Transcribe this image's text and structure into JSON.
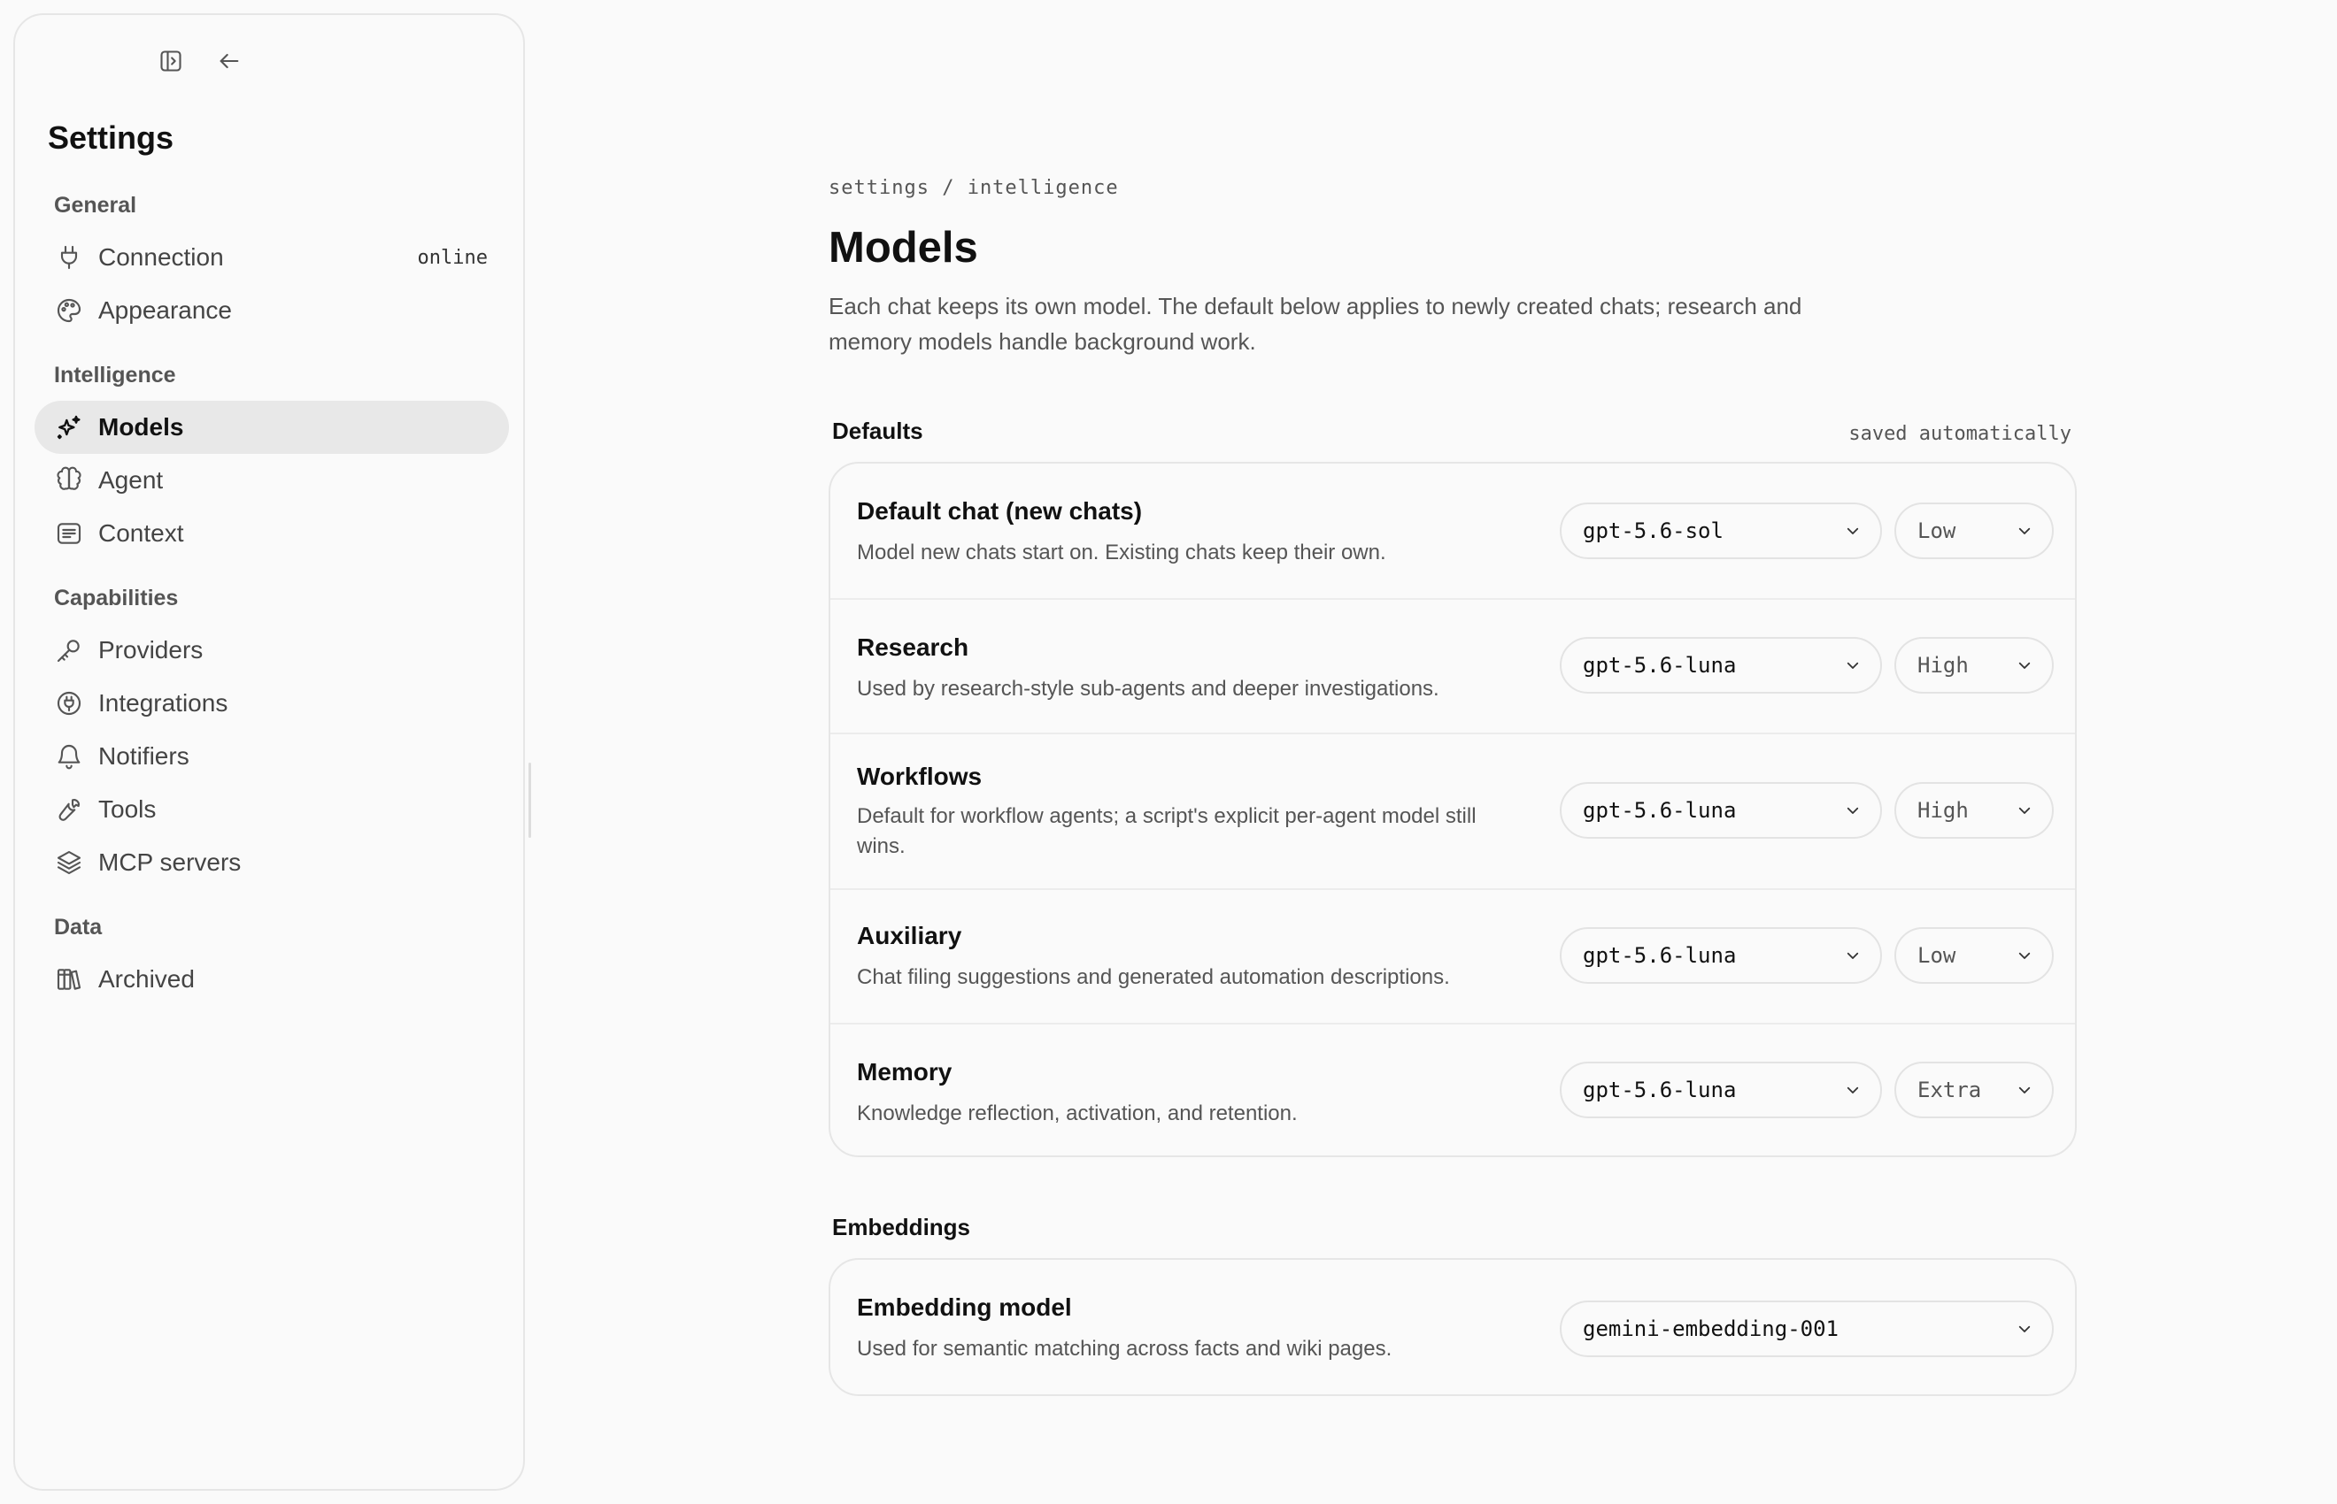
{
  "sidebar": {
    "title": "Settings",
    "groups": [
      {
        "label": "General"
      },
      {
        "label": "Intelligence"
      },
      {
        "label": "Capabilities"
      },
      {
        "label": "Data"
      }
    ],
    "items": [
      {
        "label": "Connection",
        "badge": "online",
        "icon": "plug-icon"
      },
      {
        "label": "Appearance",
        "icon": "palette-icon"
      },
      {
        "label": "Models",
        "icon": "sparkles-icon",
        "active": true
      },
      {
        "label": "Agent",
        "icon": "brain-icon"
      },
      {
        "label": "Context",
        "icon": "list-icon"
      },
      {
        "label": "Providers",
        "icon": "key-icon"
      },
      {
        "label": "Integrations",
        "icon": "plug-circle-icon"
      },
      {
        "label": "Notifiers",
        "icon": "bell-icon"
      },
      {
        "label": "Tools",
        "icon": "wrench-icon"
      },
      {
        "label": "MCP servers",
        "icon": "layers-icon"
      },
      {
        "label": "Archived",
        "icon": "books-icon"
      }
    ]
  },
  "main": {
    "breadcrumb": "settings / intelligence",
    "title": "Models",
    "description": "Each chat keeps its own model. The default below applies to newly created chats; research and memory models handle background work.",
    "defaults": {
      "heading": "Defaults",
      "note": "saved automatically",
      "rows": [
        {
          "title": "Default chat (new chats)",
          "desc": "Model new chats start on. Existing chats keep their own.",
          "model": "gpt-5.6-sol",
          "effort": "Low"
        },
        {
          "title": "Research",
          "desc": "Used by research-style sub-agents and deeper investigations.",
          "model": "gpt-5.6-luna",
          "effort": "High"
        },
        {
          "title": "Workflows",
          "desc": "Default for workflow agents; a script's explicit per-agent model still wins.",
          "model": "gpt-5.6-luna",
          "effort": "High"
        },
        {
          "title": "Auxiliary",
          "desc": "Chat filing suggestions and generated automation descriptions.",
          "model": "gpt-5.6-luna",
          "effort": "Low"
        },
        {
          "title": "Memory",
          "desc": "Knowledge reflection, activation, and retention.",
          "model": "gpt-5.6-luna",
          "effort": "Extra"
        }
      ]
    },
    "embeddings": {
      "heading": "Embeddings",
      "row": {
        "title": "Embedding model",
        "desc": "Used for semantic matching across facts and wiki pages.",
        "model": "gemini-embedding-001"
      }
    }
  },
  "colors": {
    "background": "#fafafa",
    "border": "#e6e6e6",
    "active_item": "#e8e8e8",
    "text": "#111111",
    "muted": "#555555"
  }
}
